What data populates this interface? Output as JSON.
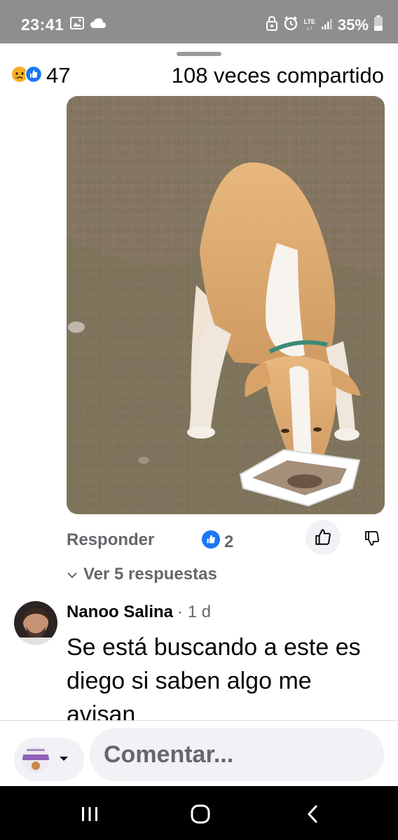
{
  "status_bar": {
    "time": "23:41",
    "network": "LTE",
    "battery": "35%",
    "icons": [
      "gallery-icon",
      "cloud-icon",
      "lock-icon",
      "alarm-icon",
      "signal-icon",
      "battery-icon"
    ]
  },
  "post_stats": {
    "reaction_count": "47",
    "reaction_icons": [
      "sad-emoji-icon",
      "like-icon"
    ],
    "shares": "108 veces compartido"
  },
  "photo": {
    "subject": "dog-eating-from-bowl"
  },
  "comment_actions": {
    "reply_label": "Responder",
    "like_count": "2",
    "view_replies_label": "Ver 5 respuestas"
  },
  "comment": {
    "author": "Nanoo Salina",
    "time": "· 1 d",
    "text": "Se está buscando a este es diego si saben algo me avisan"
  },
  "composer": {
    "placeholder": "Comentar..."
  },
  "colors": {
    "status_bar_bg": "#8e8e8e",
    "accent_blue": "#1877f2",
    "muted_text": "#65676b",
    "input_bg": "#f0f2f5"
  }
}
